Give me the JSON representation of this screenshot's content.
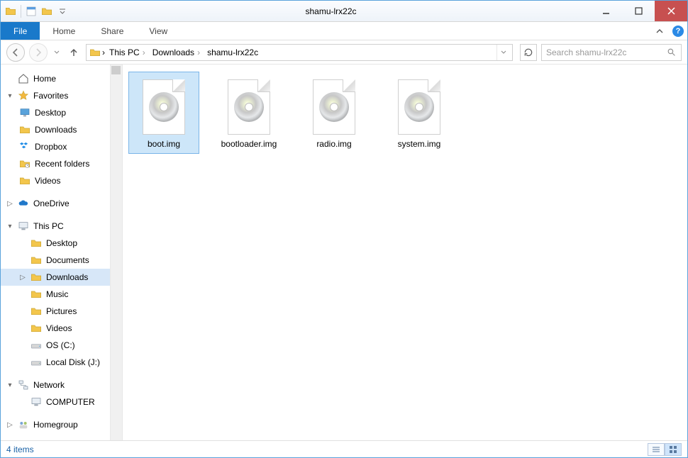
{
  "window": {
    "title": "shamu-lrx22c"
  },
  "ribbon": {
    "file": "File",
    "tabs": [
      "Home",
      "Share",
      "View"
    ]
  },
  "breadcrumbs": [
    "This PC",
    "Downloads",
    "shamu-lrx22c"
  ],
  "search": {
    "placeholder": "Search shamu-lrx22c"
  },
  "nav": {
    "home": "Home",
    "favorites": "Favorites",
    "fav_items": [
      "Desktop",
      "Downloads",
      "Dropbox",
      "Recent folders",
      "Videos"
    ],
    "onedrive": "OneDrive",
    "thispc": "This PC",
    "pc_items": [
      "Desktop",
      "Documents",
      "Downloads",
      "Music",
      "Pictures",
      "Videos",
      "OS (C:)",
      "Local Disk (J:)"
    ],
    "network": "Network",
    "net_items": [
      "COMPUTER"
    ],
    "homegroup": "Homegroup"
  },
  "files": [
    {
      "name": "boot.img",
      "selected": true
    },
    {
      "name": "bootloader.img",
      "selected": false
    },
    {
      "name": "radio.img",
      "selected": false
    },
    {
      "name": "system.img",
      "selected": false
    }
  ],
  "status": {
    "count_label": "4 items"
  }
}
